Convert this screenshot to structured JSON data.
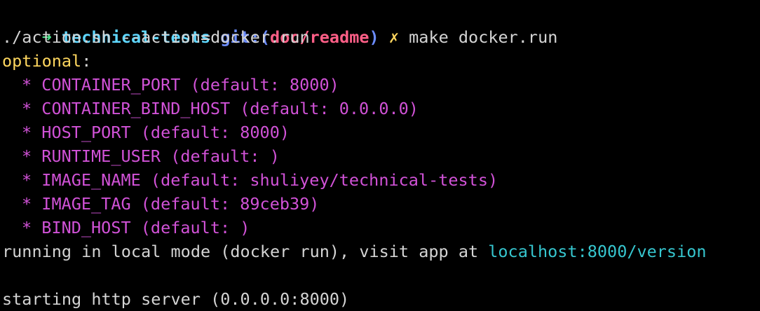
{
  "prompt": {
    "arrow": "➜",
    "repo": "technical-tests",
    "git_prefix": "git:(",
    "branch": "doc/readme",
    "git_suffix": ")",
    "dirty": "✗",
    "command": "make docker.run"
  },
  "output": {
    "action_line": "./action.sh --action=docker.run",
    "optional_label": "optional",
    "optional_colon": ":",
    "params": [
      "* CONTAINER_PORT (default: 8000)",
      "* CONTAINER_BIND_HOST (default: 0.0.0.0)",
      "* HOST_PORT (default: 8000)",
      "* RUNTIME_USER (default: )",
      "* IMAGE_NAME (default: shuliyey/technical-tests)",
      "* IMAGE_TAG (default: 89ceb39)",
      "* BIND_HOST (default: )"
    ],
    "running_text": "running in local mode (docker run), visit app at ",
    "running_link": "localhost:8000/version",
    "server_line": "starting http server (0.0.0.0:8000)"
  },
  "colors": {
    "background": "#000000",
    "arrow": "#4ee08a",
    "repo": "#5fd7ff",
    "git": "#6b8cff",
    "branch": "#ff5f87",
    "yellow": "#ffd75f",
    "magenta": "#d152d7",
    "cyan": "#36c6cf",
    "foreground": "#d4d4d4"
  }
}
